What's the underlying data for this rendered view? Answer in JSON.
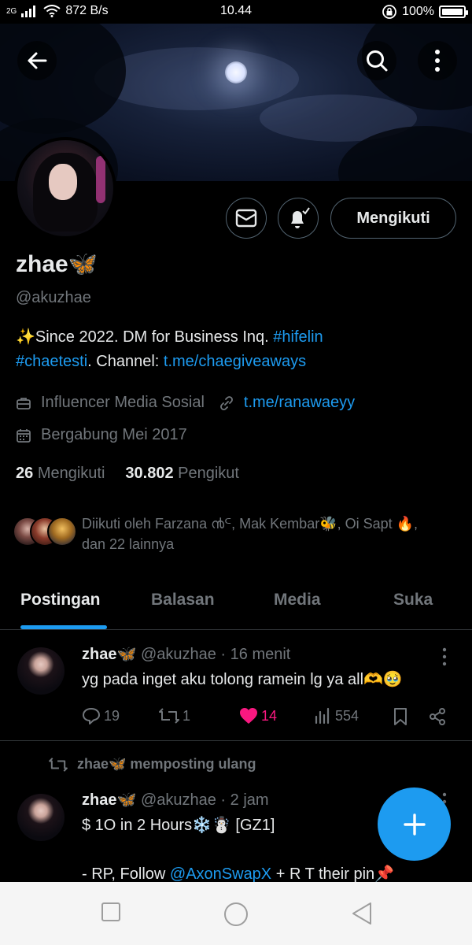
{
  "status_bar": {
    "network": "2G",
    "speed": "872 B/s",
    "time": "10.44",
    "battery": "100%",
    "battery_level": 1.0
  },
  "profile": {
    "display_name": "zhae🦋",
    "handle": "@akuzhae",
    "bio_prefix": "✨Since 2022. DM for Business Inq. ",
    "bio_tag1": "#hifelin",
    "bio_tag2": "#chaetesti",
    "bio_mid": ". Channel: ",
    "bio_link": "t.me/chaegiveaways",
    "category": "Influencer Media Sosial",
    "website": "t.me/ranawaeyy",
    "joined": "Bergabung Mei 2017",
    "following_count": "26",
    "following_label": "Mengikuti",
    "followers_count": "30.802",
    "followers_label": "Pengikut",
    "followed_by_line1": "Diikuti oleh Farzana ൯ᒼ, Mak Kembar🐝, Oi Sapt 🔥,",
    "followed_by_line2": "dan 22 lainnya"
  },
  "actions": {
    "follow_label": "Mengikuti",
    "message_icon": "mail-icon",
    "notify_icon": "bell-check-icon"
  },
  "tabs": [
    {
      "label": "Postingan",
      "active": true
    },
    {
      "label": "Balasan",
      "active": false
    },
    {
      "label": "Media",
      "active": false
    },
    {
      "label": "Suka",
      "active": false
    }
  ],
  "posts": [
    {
      "name": "zhae🦋",
      "handle": "@akuzhae",
      "time": "· 16 menit",
      "text": "yg pada inget aku tolong ramein lg ya all🫶🥹",
      "replies": "19",
      "reposts": "1",
      "likes": "14",
      "views": "554",
      "liked": true
    },
    {
      "repost_label": "zhae🦋 memposting ulang",
      "name": "zhae🦋",
      "handle": "@akuzhae",
      "time": "· 2 jam",
      "text_line1": "$ 1O in 2 Hours❄️☃️ [GZ1]",
      "text_line3_prefix": "- RP, Follow ",
      "text_line3_link": "@AxonSwapX",
      "text_line3_suffix": " + R T their pin📌"
    }
  ],
  "colors": {
    "accent": "#1d9bf0",
    "like": "#f91880",
    "muted": "#71767b",
    "text": "#e7e9ea",
    "background": "#000000"
  }
}
